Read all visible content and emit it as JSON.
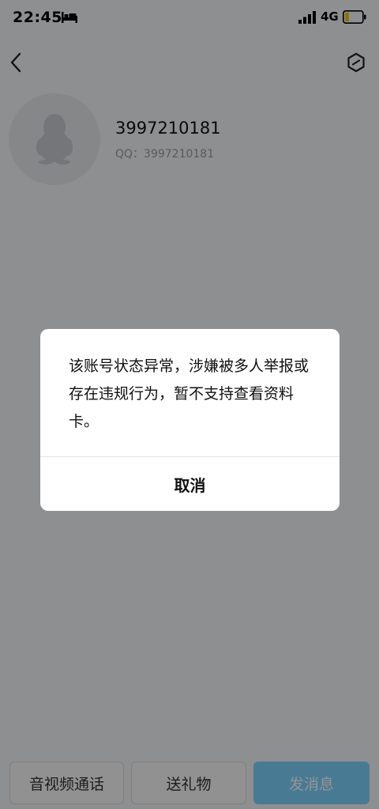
{
  "status_bar": {
    "time": "22:45",
    "network": "4G"
  },
  "profile": {
    "nickname": "3997210181",
    "qq_line": "QQ：3997210181"
  },
  "dialog": {
    "message": "该账号状态异常，涉嫌被多人举报或存在违规行为，暂不支持查看资料卡。",
    "cancel_label": "取消"
  },
  "bottom_bar": {
    "call_label": "音视频通话",
    "gift_label": "送礼物",
    "message_label": "发消息"
  },
  "colors": {
    "message_button": "#7fd2ff",
    "overlay": "rgba(0,0,0,0.42)"
  },
  "icons": [
    "bed-icon",
    "signal-icon",
    "battery-icon",
    "back-arrow-icon",
    "share-icon",
    "penguin-avatar-icon"
  ]
}
